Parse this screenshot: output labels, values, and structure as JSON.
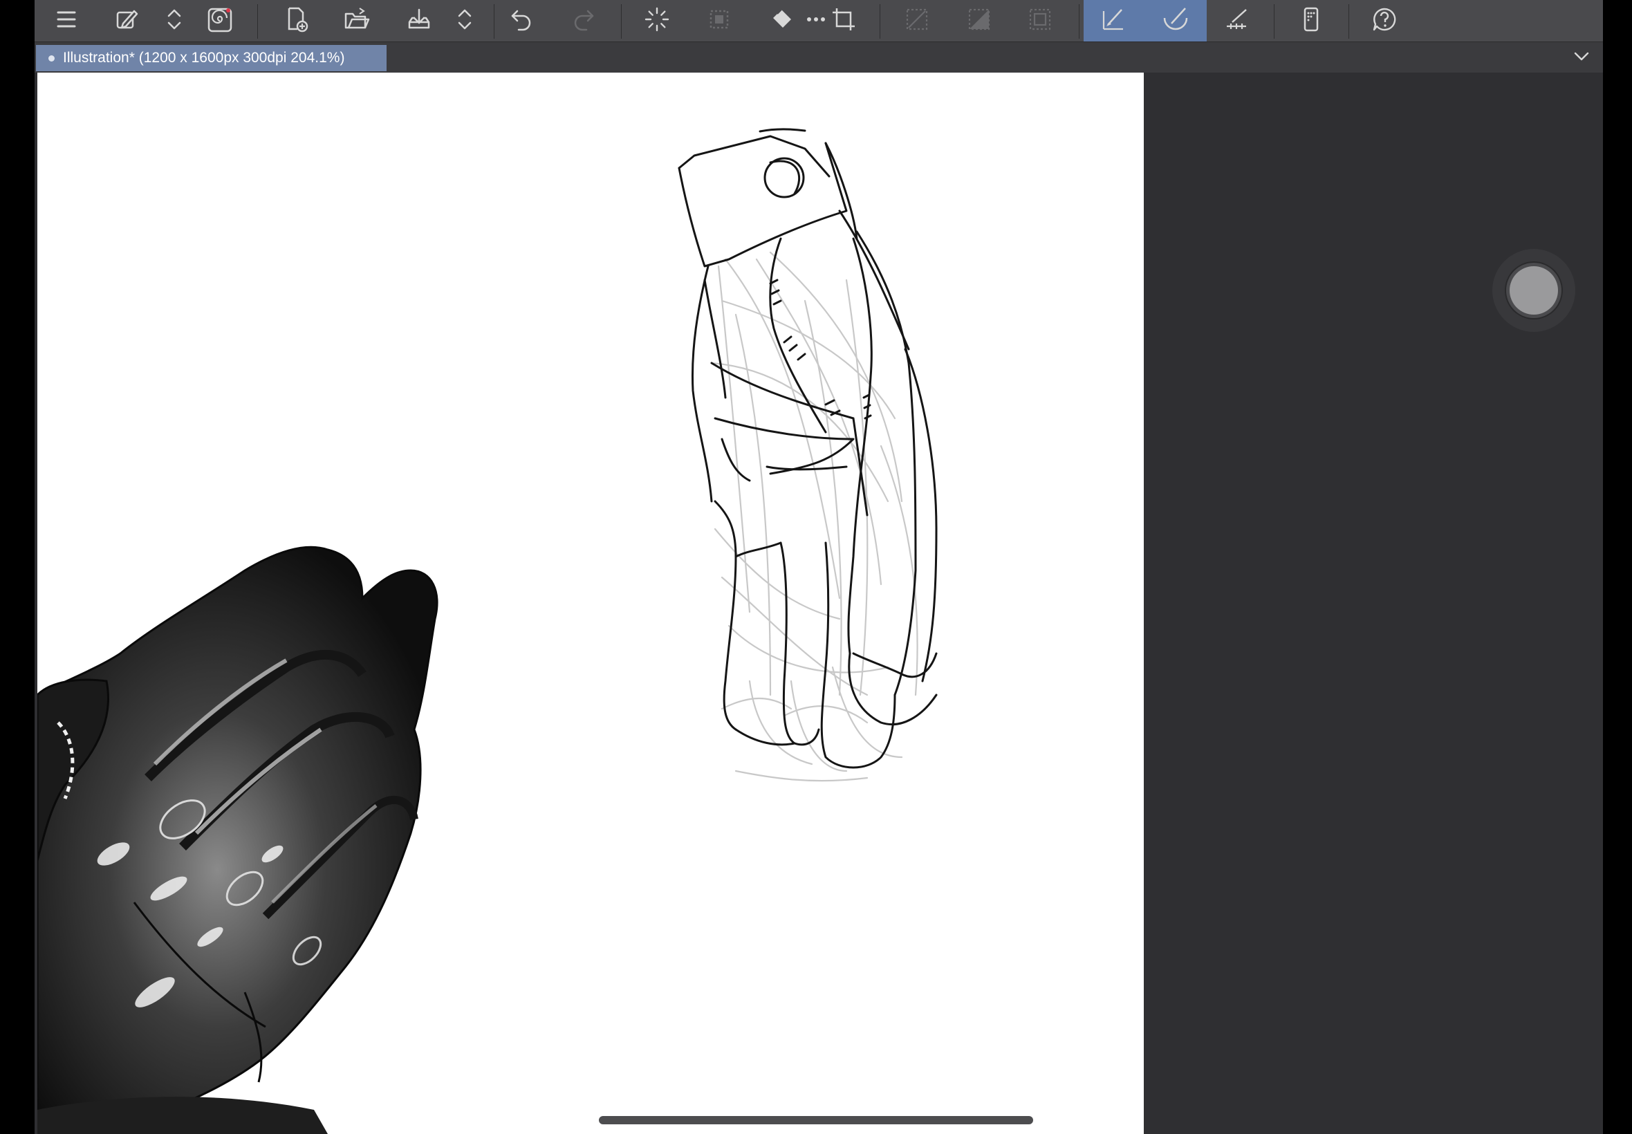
{
  "toolbar": {
    "buttons": [
      {
        "name": "menu-icon"
      },
      {
        "name": "edit-brush-icon"
      },
      {
        "name": "up-down-toggle-icon"
      },
      {
        "name": "spiral-icon"
      },
      {
        "name": "new-canvas-icon"
      },
      {
        "name": "open-folder-icon"
      },
      {
        "name": "save-icon"
      },
      {
        "name": "save-options-icon"
      },
      {
        "name": "undo-icon"
      },
      {
        "name": "redo-icon"
      },
      {
        "name": "loading-spinner-icon"
      },
      {
        "name": "deselect-icon"
      },
      {
        "name": "fill-icon"
      },
      {
        "name": "more-dots-icon"
      },
      {
        "name": "transform-icon"
      },
      {
        "name": "clear-selection-icon"
      },
      {
        "name": "invert-selection-icon"
      },
      {
        "name": "selection-border-icon"
      },
      {
        "name": "pen-snap-icon"
      },
      {
        "name": "curve-snap-icon"
      },
      {
        "name": "ruler-snap-icon"
      },
      {
        "name": "device-settings-icon"
      },
      {
        "name": "help-icon"
      }
    ],
    "colors": {
      "bg": "#4a4a4d",
      "active": "#5e7aa9",
      "icon": "#d8d8d8",
      "icon_dim": "#6a6a6d"
    }
  },
  "document_tab": {
    "title": "Illustration* (1200 x 1600px 300dpi 204.1%)",
    "color": "#7084a8"
  },
  "canvas": {
    "background": "#ffffff",
    "content": "hand-and-glove-sketch"
  },
  "brush_size_indicator": {
    "color": "#9a9a9c"
  }
}
